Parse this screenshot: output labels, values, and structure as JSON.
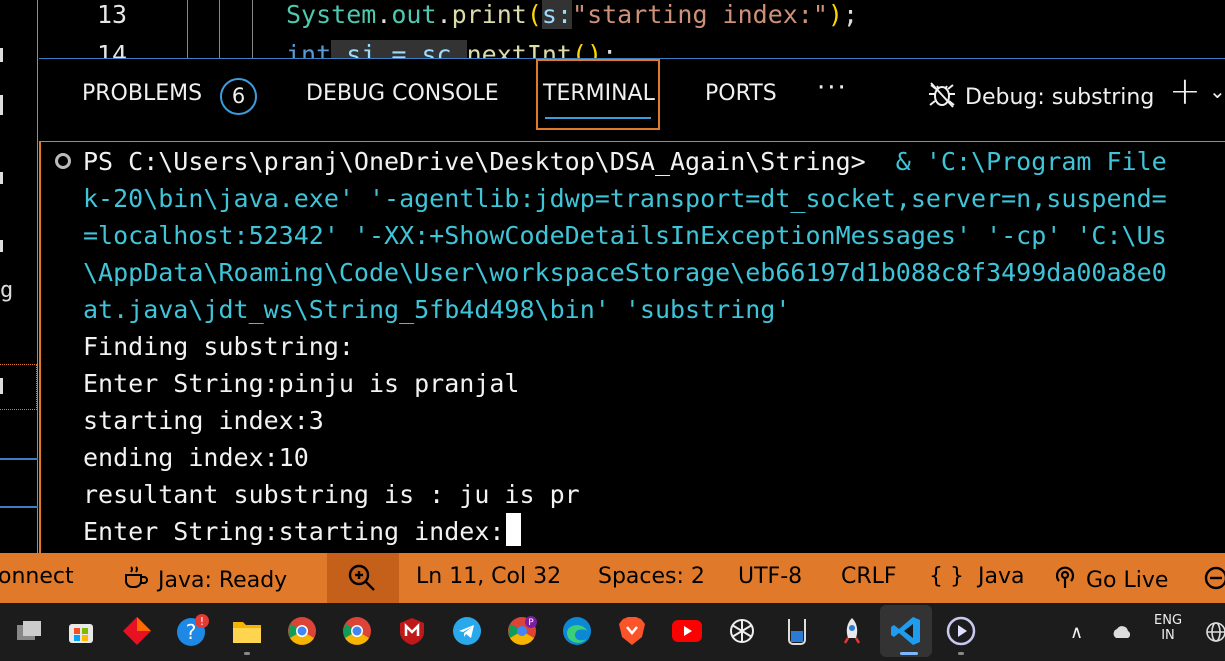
{
  "editor": {
    "lines": [
      {
        "number": "13",
        "tokens": [
          {
            "t": "System",
            "c": "tk-type"
          },
          {
            "t": ".",
            "c": "tk-punc"
          },
          {
            "t": "out",
            "c": "tk-type"
          },
          {
            "t": ".",
            "c": "tk-punc"
          },
          {
            "t": "print",
            "c": "tk-fn"
          },
          {
            "t": "(",
            "c": "tk-brace"
          },
          {
            "t": "s:",
            "c": "tk-param"
          },
          {
            "t": "\"starting index:\"",
            "c": "tk-str"
          },
          {
            "t": ")",
            "c": "tk-brace"
          },
          {
            "t": ";",
            "c": "tk-punc"
          }
        ]
      },
      {
        "number": "14",
        "tokens": [
          {
            "t": "int",
            "c": "tk-kw"
          },
          {
            "t": " si = sc.",
            "c": "tk-param"
          },
          {
            "t": "nextInt",
            "c": "tk-fn"
          },
          {
            "t": "()",
            "c": "tk-brace"
          },
          {
            "t": ";",
            "c": "tk-punc"
          }
        ]
      }
    ]
  },
  "panel": {
    "tabs": {
      "problems": "PROBLEMS",
      "problems_count": "6",
      "debug_console": "DEBUG CONSOLE",
      "terminal": "TERMINAL",
      "ports": "PORTS"
    },
    "more": "···",
    "debug_label": "Debug: substring",
    "active_tab": "TERMINAL"
  },
  "terminal": {
    "prompt_line": "PS C:\\Users\\pranj\\OneDrive\\Desktop\\DSA_Again\\String>",
    "cmd_line_1": "  & 'C:\\Program File",
    "cmd_line_2": "k-20\\bin\\java.exe' '-agentlib:jdwp=transport=dt_socket,server=n,suspend=",
    "cmd_line_3": "=localhost:52342' '-XX:+ShowCodeDetailsInExceptionMessages' '-cp' 'C:\\Us",
    "cmd_line_4": "\\AppData\\Roaming\\Code\\User\\workspaceStorage\\eb66197d1b088c8f3499da00a8e0",
    "cmd_line_5": "at.java\\jdt_ws\\String_5fb4d498\\bin' 'substring'",
    "out_1": "Finding substring:",
    "out_2": "Enter String:pinju is pranjal",
    "out_3": "starting index:3",
    "out_4": "ending index:10",
    "out_5": "resultant substring is : ju is pr",
    "out_6": "Enter String:starting index:"
  },
  "status_bar": {
    "connect": "onnect",
    "java_status": "Java: Ready",
    "position": "Ln 11, Col 32",
    "spaces": "Spaces: 2",
    "encoding": "UTF-8",
    "eol": "CRLF",
    "language": "Java",
    "language_icon": "{ }",
    "go_live": "Go Live"
  },
  "taskbar": {
    "language": "ENG",
    "region": "IN"
  },
  "colors": {
    "accent": "#e07a2a",
    "focus_blue": "#3a9de0",
    "terminal_cyan": "#3fc4d8"
  }
}
